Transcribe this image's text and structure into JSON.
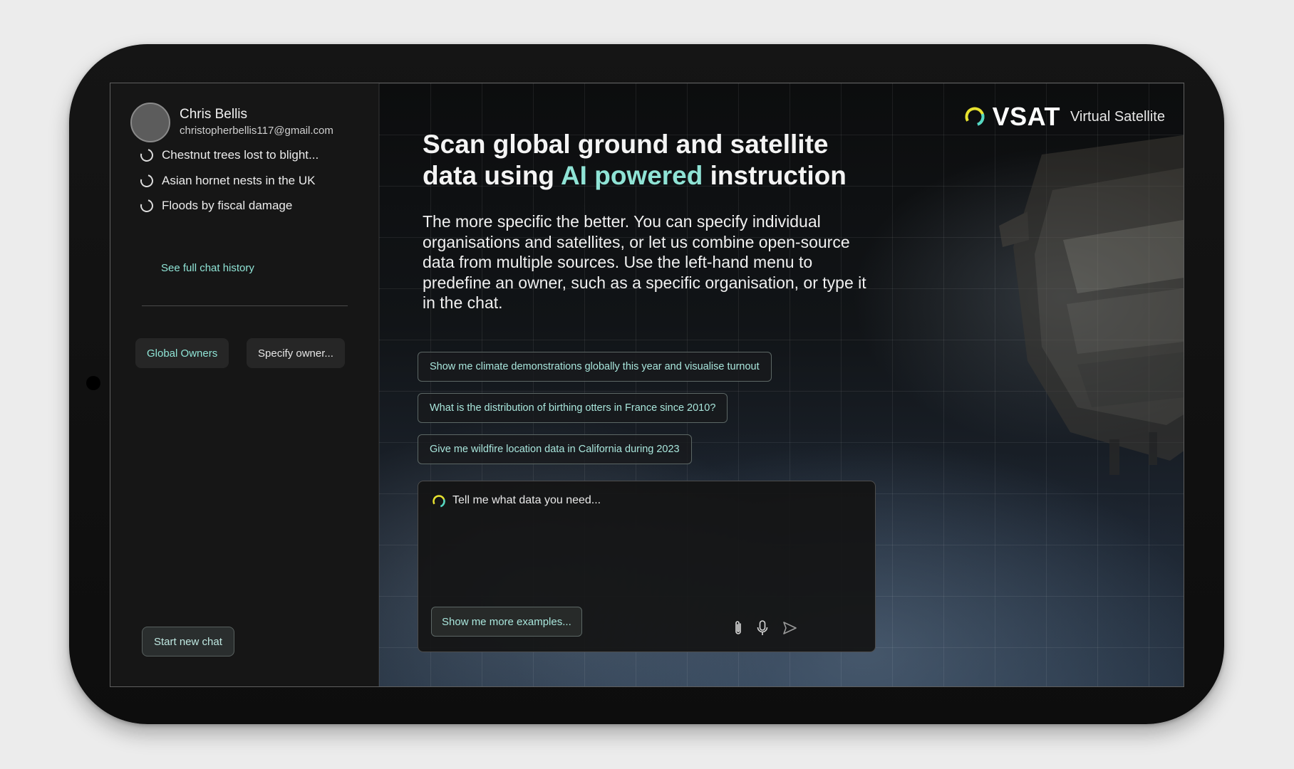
{
  "user": {
    "name": "Chris Bellis",
    "email": "christopherbellis117@gmail.com"
  },
  "history": {
    "items": [
      {
        "label": "Chestnut trees lost to blight..."
      },
      {
        "label": "Asian hornet nests in the UK"
      },
      {
        "label": "Floods by fiscal damage"
      }
    ],
    "see_all_label": "See full chat history"
  },
  "owners": {
    "global_label": "Global Owners",
    "specify_label": "Specify owner..."
  },
  "start_new_chat_label": "Start new chat",
  "brand": {
    "name": "VSAT",
    "tagline": "Virtual Satellite"
  },
  "headline": {
    "line1": "Scan global ground and satellite",
    "line2_prefix": "data using ",
    "line2_accent": "AI powered",
    "line2_suffix": " instruction"
  },
  "intro": "The more specific the better. You can specify individual organisations and satellites, or let us combine open-source data from multiple sources. Use the left-hand menu to predefine an owner, such as a specific organisation, or type it in the chat.",
  "suggestions": [
    {
      "label": "Show me climate demonstrations globally this year and visualise turnout"
    },
    {
      "label": "What is the distribution of birthing otters in France since 2010?"
    },
    {
      "label": "Give me wildfire location data in California during 2023"
    }
  ],
  "chat": {
    "placeholder": "Tell me what data you need...",
    "more_examples_label": "Show me more examples..."
  },
  "icons": {
    "history": "ring-icon",
    "attach": "paperclip-icon",
    "mic": "microphone-icon",
    "send": "send-icon",
    "logo": "vsat-ring-logo"
  },
  "colors": {
    "accent": "#8fe3d5",
    "logo_yellow": "#e7e22f",
    "logo_teal": "#53d6c4",
    "device_body": "#111111",
    "sidebar_bg": "#161616"
  }
}
